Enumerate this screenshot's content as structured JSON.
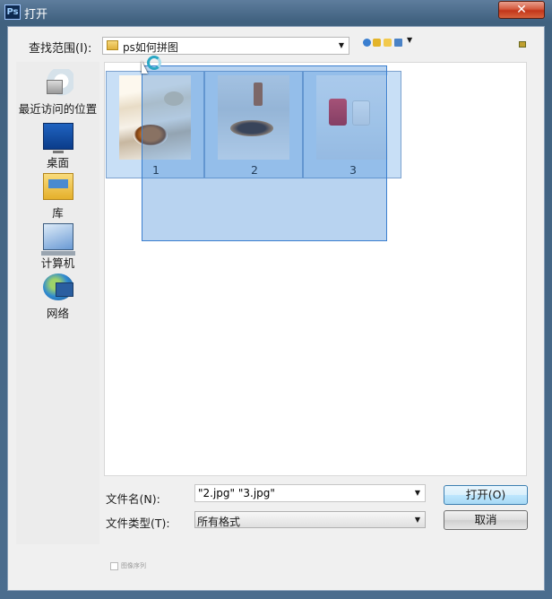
{
  "window": {
    "app_icon": "Ps",
    "title": "打开",
    "close_icon": "close-icon"
  },
  "toolbar": {
    "look_in_label": "查找范围(I):",
    "look_in_value": "ps如何拼图",
    "icons": [
      "back-icon",
      "up-folder-icon",
      "new-folder-icon",
      "view-menu-icon"
    ]
  },
  "places": [
    {
      "label": "最近访问的位置",
      "icon": "recent-places-icon"
    },
    {
      "label": "桌面",
      "icon": "desktop-icon"
    },
    {
      "label": "库",
      "icon": "libraries-icon"
    },
    {
      "label": "计算机",
      "icon": "computer-icon"
    },
    {
      "label": "网络",
      "icon": "network-icon"
    }
  ],
  "files": [
    {
      "name": "1",
      "thumbnail": "breakfast-pancakes-photo",
      "selected": true
    },
    {
      "name": "2",
      "thumbnail": "burger-photo",
      "selected": true
    },
    {
      "name": "3",
      "thumbnail": "drinks-cups-photo",
      "selected": true
    }
  ],
  "form": {
    "file_name_label": "文件名(N):",
    "file_name_value": "\"2.jpg\" \"3.jpg\"",
    "file_type_label": "文件类型(T):",
    "file_type_value": "所有格式"
  },
  "buttons": {
    "open": "打开(O)",
    "cancel": "取消"
  },
  "image_sequence_label": "图像序列"
}
